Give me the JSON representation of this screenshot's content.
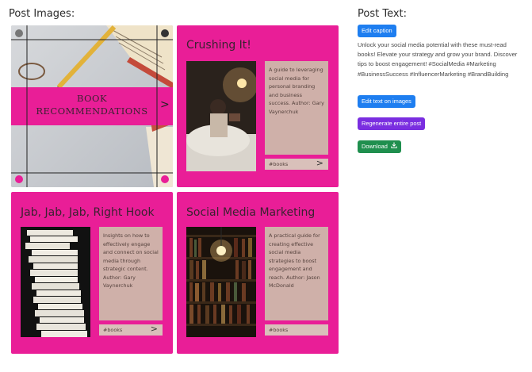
{
  "headers": {
    "post_images": "Post Images:",
    "post_text": "Post Text:"
  },
  "cards": [
    {
      "title": "BOOK RECOMMENDATIONS",
      "arrow": ">"
    },
    {
      "title": "Crushing It!",
      "description": "A guide to leveraging social media for personal branding and business success. Author: Gary Vaynerchuk",
      "tag": "#books",
      "arrow": ">"
    },
    {
      "title": "Jab, Jab, Jab, Right Hook",
      "description": "Insights on how to effectively engage and connect on social media through strategic content. Author: Gary Vaynerchuk",
      "tag": "#books",
      "arrow": ">"
    },
    {
      "title": "Social Media Marketing",
      "description": "A practical guide for creating effective social media strategies to boost engagement and reach. Author: Jason McDonald",
      "tag": "#books"
    }
  ],
  "buttons": {
    "edit_caption": "Edit caption",
    "edit_text_images": "Edit text on images",
    "regenerate": "Regenerate entire post",
    "download": "Download"
  },
  "caption": "Unlock your social media potential with these must-read books! Elevate your strategy and grow your brand. Discover tips to boost engagement! #SocialMedia #Marketing #BusinessSuccess #InfluencerMarketing #BrandBuilding",
  "colors": {
    "card_bg": "#e91e97",
    "edit_buttons": "#1e7ef0",
    "regenerate_button": "#7a2ee0",
    "download_button": "#1f8f4e"
  },
  "icons": [
    "download-icon",
    "chevron-right-icon"
  ]
}
